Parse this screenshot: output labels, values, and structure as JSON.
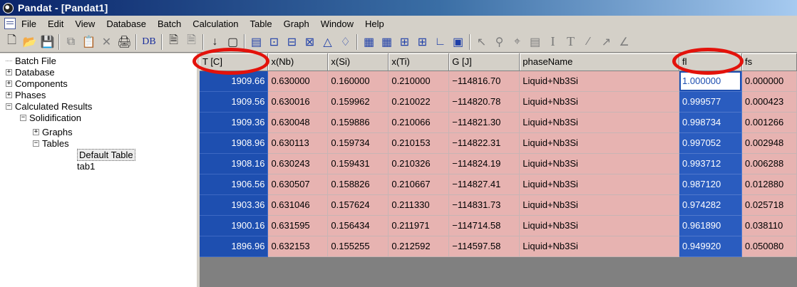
{
  "window": {
    "title": "Pandat - [Pandat1]"
  },
  "menu": [
    "File",
    "Edit",
    "View",
    "Database",
    "Batch",
    "Calculation",
    "Table",
    "Graph",
    "Window",
    "Help"
  ],
  "toolbar": {
    "db_label": "DB",
    "text_tool": "T",
    "italic_tool": "I"
  },
  "tree": {
    "batch_file": "Batch File",
    "database": "Database",
    "components": "Components",
    "phases": "Phases",
    "calculated_results": "Calculated Results",
    "solidification": "Solidification",
    "graphs": "Graphs",
    "tables": "Tables",
    "default_table": "Default Table",
    "tab1": "tab1",
    "expand_symbol": "+",
    "collapse_symbol": "−"
  },
  "table": {
    "headers": [
      "T [C]",
      "x(Nb)",
      "x(Si)",
      "x(Ti)",
      "G [J]",
      "phaseName",
      "fl",
      "fs"
    ],
    "rows": [
      [
        "1909.66",
        "0.630000",
        "0.160000",
        "0.210000",
        "−114816.70",
        "Liquid+Nb3Si",
        "1.000000",
        "0.000000"
      ],
      [
        "1909.56",
        "0.630016",
        "0.159962",
        "0.210022",
        "−114820.78",
        "Liquid+Nb3Si",
        "0.999577",
        "0.000423"
      ],
      [
        "1909.36",
        "0.630048",
        "0.159886",
        "0.210066",
        "−114821.30",
        "Liquid+Nb3Si",
        "0.998734",
        "0.001266"
      ],
      [
        "1908.96",
        "0.630113",
        "0.159734",
        "0.210153",
        "−114822.31",
        "Liquid+Nb3Si",
        "0.997052",
        "0.002948"
      ],
      [
        "1908.16",
        "0.630243",
        "0.159431",
        "0.210326",
        "−114824.19",
        "Liquid+Nb3Si",
        "0.993712",
        "0.006288"
      ],
      [
        "1906.56",
        "0.630507",
        "0.158826",
        "0.210667",
        "−114827.41",
        "Liquid+Nb3Si",
        "0.987120",
        "0.012880"
      ],
      [
        "1903.36",
        "0.631046",
        "0.157624",
        "0.211330",
        "−114831.73",
        "Liquid+Nb3Si",
        "0.974282",
        "0.025718"
      ],
      [
        "1900.16",
        "0.631595",
        "0.156434",
        "0.211971",
        "−114714.58",
        "Liquid+Nb3Si",
        "0.961890",
        "0.038110"
      ],
      [
        "1896.96",
        "0.632153",
        "0.155255",
        "0.212592",
        "−114597.58",
        "Liquid+Nb3Si",
        "0.949920",
        "0.050080"
      ]
    ]
  },
  "colors": {
    "title_bar": "#0a246a",
    "selected_column": "#1e4fb0",
    "row_fill": "#e7b3b1",
    "highlight_circle": "#e3120b"
  }
}
